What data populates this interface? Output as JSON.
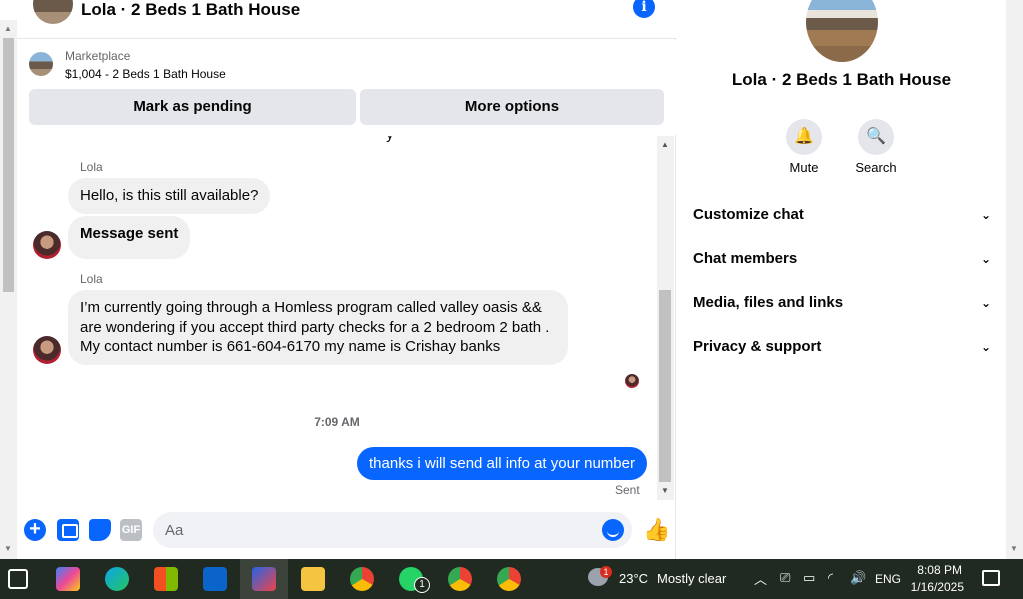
{
  "chat": {
    "header_title": "Lola · 2 Beds 1 Bath House",
    "info_icon": "i",
    "listing": {
      "category": "Marketplace",
      "title": "$1,004 - 2 Beds 1 Bath House"
    },
    "actions": {
      "pending": "Mark as pending",
      "more": "More options"
    },
    "messages": [
      {
        "sender": "Lola",
        "text": "Hello, is this still available?"
      },
      {
        "text": "Message sent"
      },
      {
        "sender": "Lola",
        "lines": [
          "I’m currently going through a Homless program called valley oasis  &&",
          "are wondering if you accept third party checks for a 2 bedroom 2 bath .",
          "My contact number is 661-604-6170 my name is Crishay banks"
        ]
      }
    ],
    "timestamp": "7:09 AM",
    "outgoing": "thanks i will send all info at your number",
    "status": "Sent",
    "composer": {
      "placeholder": "Aa",
      "gif": "GIF"
    }
  },
  "panel": {
    "title": "Lola · 2 Beds 1 Bath House",
    "mute": "Mute",
    "search": "Search",
    "sections": [
      "Customize chat",
      "Chat members",
      "Media, files and links",
      "Privacy & support"
    ]
  },
  "taskbar": {
    "weather_temp": "23°C",
    "weather_desc": "Mostly clear",
    "weather_badge": "1",
    "whatsapp_badge": "1",
    "lang": "ENG",
    "time": "8:08 PM",
    "date": "1/16/2025",
    "icons": [
      "task-view-icon",
      "copilot-icon",
      "edge-icon",
      "store-icon",
      "outlook-icon",
      "photo-app-icon",
      "file-explorer-icon",
      "chrome-icon",
      "whatsapp-icon",
      "chrome-profile-c-icon",
      "chrome-profile-icon"
    ]
  }
}
